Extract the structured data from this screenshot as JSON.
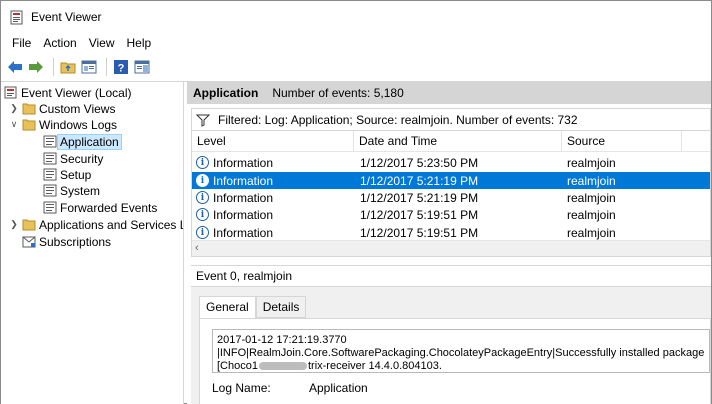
{
  "window": {
    "title": "Event Viewer"
  },
  "menu": [
    "File",
    "Action",
    "View",
    "Help"
  ],
  "tree": {
    "root": "Event Viewer (Local)",
    "custom_views": "Custom Views",
    "windows_logs": "Windows Logs",
    "logs": [
      "Application",
      "Security",
      "Setup",
      "System",
      "Forwarded Events"
    ],
    "app_services": "Applications and Services Lo",
    "subscriptions": "Subscriptions"
  },
  "header": {
    "title": "Application",
    "count": "Number of events: 5,180"
  },
  "filter": {
    "text": "Filtered: Log: Application; Source: realmjoin. Number of events: 732"
  },
  "grid": {
    "columns": [
      "Level",
      "Date and Time",
      "Source"
    ],
    "rows": [
      {
        "level": "Information",
        "date": "1/12/2017 5:23:50 PM",
        "source": "realmjoin"
      },
      {
        "level": "Information",
        "date": "1/12/2017 5:21:19 PM",
        "source": "realmjoin"
      },
      {
        "level": "Information",
        "date": "1/12/2017 5:21:19 PM",
        "source": "realmjoin"
      },
      {
        "level": "Information",
        "date": "1/12/2017 5:19:51 PM",
        "source": "realmjoin"
      },
      {
        "level": "Information",
        "date": "1/12/2017 5:19:51 PM",
        "source": "realmjoin"
      }
    ],
    "selected_index": 1
  },
  "detail": {
    "title": "Event 0, realmjoin",
    "tabs": [
      "General",
      "Details"
    ],
    "description": {
      "line1": "2017-01-12 17:21:19.3770",
      "line2": "|INFO|RealmJoin.Core.SoftwarePackaging.ChocolateyPackageEntry|Successfully installed package",
      "line3_prefix": "[Choco1",
      "line3_suffix": "trix-receiver 14.4.0.804103."
    },
    "log_name_label": "Log Name:",
    "log_name_value": "Application"
  }
}
